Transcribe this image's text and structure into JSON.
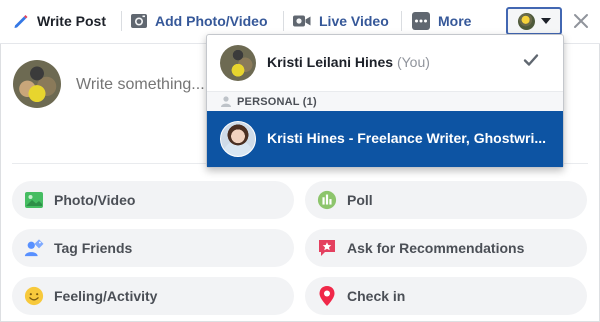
{
  "composer": {
    "tabs": [
      {
        "label": "Write Post",
        "icon": "pencil-icon"
      },
      {
        "label": "Add Photo/Video",
        "icon": "camera-icon"
      },
      {
        "label": "Live Video",
        "icon": "video-camera-icon"
      },
      {
        "label": "More",
        "icon": "more-dots-icon"
      }
    ],
    "placeholder": "Write something...",
    "colors": {
      "link_blue": "#365899",
      "selected_blue": "#0d54a3",
      "pill_bg": "#f2f3f5"
    }
  },
  "actions": [
    {
      "label": "Photo/Video",
      "icon": "photo-icon"
    },
    {
      "label": "Poll",
      "icon": "poll-icon"
    },
    {
      "label": "Tag Friends",
      "icon": "tag-friends-icon"
    },
    {
      "label": "Ask for Recommendations",
      "icon": "recommendation-icon"
    },
    {
      "label": "Feeling/Activity",
      "icon": "smiley-icon"
    },
    {
      "label": "Check in",
      "icon": "location-pin-icon"
    }
  ],
  "identity_dropdown": {
    "current_user": {
      "name": "Kristi Leilani Hines",
      "suffix": "(You)"
    },
    "section_label": "PERSONAL (1)",
    "page": {
      "name": "Kristi Hines - Freelance Writer, Ghostwri..."
    }
  }
}
